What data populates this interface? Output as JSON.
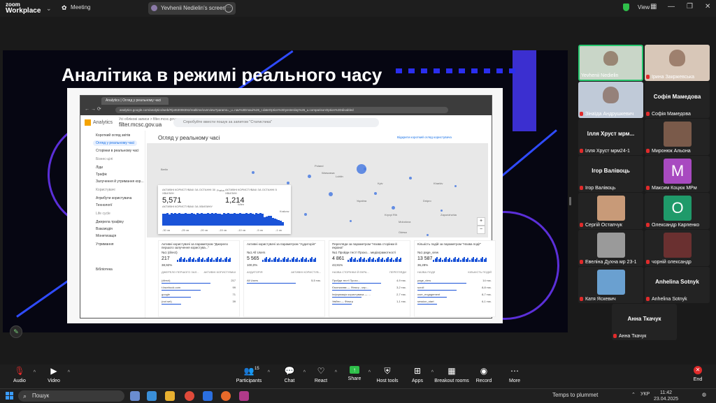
{
  "app": {
    "brand_line1": "zoom",
    "brand_line2": "Workplace",
    "meeting_label": "Meeting",
    "share_title": "Yevhenii Nedielin's screen",
    "view_label": "View"
  },
  "slide": {
    "title": "Аналітика в режимі реального часу",
    "browser_tab": "Analytics | Огляд у реальному часі",
    "url": "analytics.google.com/analytics/web/#/p463008392/realtime/overview?params=_u..nav%3Dmaui%26_r.dateOption%3Dyesterday%26_u.comparisonOption%3Ddisabled",
    "ga_title": "Analytics",
    "ga_property_small": "Усі облікові записи > filter.mcsc.gov.ua",
    "ga_property": "filter.mcsc.gov.ua",
    "ga_search": "Спробуйте ввести пошук за запитом \"Статистика\"",
    "sidebar": [
      {
        "label": "Короткий огляд звітів",
        "type": "item"
      },
      {
        "label": "Огляд у реальному часі",
        "type": "selected"
      },
      {
        "label": "Сторінки в реальному часі",
        "type": "item"
      },
      {
        "label": "Бізнес-цілі",
        "type": "section"
      },
      {
        "label": "Ліди",
        "type": "item"
      },
      {
        "label": "Трафік",
        "type": "item"
      },
      {
        "label": "Залучення й утримання кор...",
        "type": "item"
      },
      {
        "label": "Користувачі",
        "type": "section"
      },
      {
        "label": "Атрибути користувача",
        "type": "item"
      },
      {
        "label": "Технології",
        "type": "item"
      },
      {
        "label": "Life cycle",
        "type": "section"
      },
      {
        "label": "Джерела трафіку",
        "type": "item"
      },
      {
        "label": "Взаємодія",
        "type": "item"
      },
      {
        "label": "Монетизація",
        "type": "item"
      },
      {
        "label": "Утримання",
        "type": "item"
      },
      {
        "label": "Бібліотека",
        "type": "item"
      }
    ],
    "rt_title": "Огляд у реальному часі",
    "rt_link": "Відкрити короткий огляд користувача",
    "map_labels": [
      "Poland",
      "Warszawa",
      "Lublin",
      "Kyiv",
      "Berlin",
      "Praha",
      "Wien",
      "Україна",
      "Molodova",
      "Kharkiv",
      "Dnipro",
      "Odesa",
      "Krakow",
      "Kryvyi Rih",
      "Zaporizhzhia"
    ],
    "card": {
      "h1": "АКТИВНІ КОРИСТУВАЧІ ЗА ОСТАННІ 30 ХВИЛИН",
      "v1": "5,571",
      "sub1": "АКТИВНІ КОРИСТУВАЧІ ЗА ХВИЛИНУ",
      "h2": "АКТИВНІ КОРИСТУВАЧІ ЗА ОСТАННІ 5 ХВИЛИН",
      "v2": "1,214",
      "bars": [
        72,
        70,
        75,
        68,
        74,
        71,
        76,
        70,
        73,
        69,
        72,
        75,
        71,
        70,
        74,
        72,
        68,
        73,
        71,
        76,
        70,
        72,
        74,
        69,
        73,
        71,
        75,
        70,
        72,
        68,
        74,
        71,
        73,
        70,
        72,
        75,
        71,
        69,
        74,
        72,
        70,
        73,
        71,
        75,
        72,
        68,
        74,
        70,
        73,
        71,
        52,
        55,
        60,
        58,
        45,
        40,
        38,
        35,
        30,
        20
      ],
      "axis": [
        "-30 хв",
        "-25 хв",
        "-20 хв",
        "-15 хв",
        "-10 хв",
        "-5 хв",
        "-1 хв"
      ]
    },
    "panels": [
      {
        "title": "Активні користувачі за параметром \"Джерело першого залучення користува...\"",
        "sub": "№1 (direct)",
        "num": "217",
        "pct": "38,92%",
        "cols": [
          "ДЖЕРЕЛО ПЕРШОГО ЗАЛ...",
          "АКТИВНІ КОРИСТУВАЧІ"
        ],
        "rows": [
          [
            "(direct)",
            "217"
          ],
          [
            "t.facebook.com",
            "99"
          ],
          [
            "google",
            "71"
          ],
          [
            "(not set)",
            "39"
          ]
        ]
      },
      {
        "title": "Активні користувачі за параметром \"Аудиторія\"",
        "sub": "№1 All Users",
        "num": "5 565",
        "pct": "100,0%",
        "cols": [
          "АУДИТОРІЯ",
          "АКТИВНІ КОРИСТУВ..."
        ],
        "rows": [
          [
            "All Users",
            "5,5 тис."
          ]
        ]
      },
      {
        "title": "Перегляди за параметром \"Назва сторінки й екрана\"",
        "sub": "№1 Пройди тест! Прохо... медіаграмотності",
        "num": "4 861",
        "pct": "43,91%",
        "cols": [
          "НАЗВА СТОРІНКИ Й ЕКРА...",
          "ПЕРЕГЛЯДИ"
        ],
        "rows": [
          [
            "Пройди тест! Прохо...",
            "4,9 тис."
          ],
          [
            "Ємоткаєвм — Фільтр - кер...",
            "3,2 тис."
          ],
          [
            "Інформація користувача — ...",
            "2,7 тис."
          ],
          [
            "Увійти — Фільтр",
            "1,1 тис."
          ]
        ]
      },
      {
        "title": "Кількість подій за параметром \"Назва події\"",
        "sub": "№1 page_view",
        "num": "13 587",
        "pct": "36,28%",
        "cols": [
          "НАЗВА ПОДІЇ",
          "КІЛЬКІСТЬ ПОДІЙ"
        ],
        "rows": [
          [
            "page_view",
            "14 тис."
          ],
          [
            "scroll",
            "8,8 тис."
          ],
          [
            "user_engagement",
            "8,7 тис."
          ],
          [
            "session_start",
            "6,1 тис."
          ]
        ]
      }
    ]
  },
  "participants": [
    {
      "name": "Yevhenii Nedielin",
      "kind": "photo",
      "muted": false,
      "active": true,
      "color": "#c9d6c8"
    },
    {
      "name": "Ірина Закржевська",
      "kind": "photo",
      "muted": true,
      "color": "#d8c7b8"
    },
    {
      "name": "Зінаїда Андрушкевич",
      "kind": "photo",
      "muted": true,
      "color": "#c0cad8"
    },
    {
      "name": "Софія Мамедова",
      "kind": "text",
      "big": "Софія Мамедова",
      "muted": true
    },
    {
      "name": "Ілля Хруст мрм24-1",
      "kind": "text",
      "big": "Ілля Хруст мрм...",
      "muted": true
    },
    {
      "name": "Миронюк Альона",
      "kind": "avatar",
      "muted": true,
      "color": "#7a5a4a"
    },
    {
      "name": "Ігор Валівоць",
      "kind": "text",
      "big": "Ігор Валівоць",
      "muted": true
    },
    {
      "name": "Максим Коцюк МРм",
      "kind": "letter",
      "letter": "M",
      "muted": true,
      "color": "#a84ac0"
    },
    {
      "name": "Сергій Остапчук",
      "kind": "avatar",
      "muted": true,
      "color": "#c89a78"
    },
    {
      "name": "Олександр Карпенко",
      "kind": "letter",
      "letter": "O",
      "muted": true,
      "color": "#1f9a6a"
    },
    {
      "name": "Евеліна Духна мр 23-1",
      "kind": "avatar",
      "muted": true,
      "color": "#9a9a9a"
    },
    {
      "name": "чорній олександр",
      "kind": "avatar",
      "muted": true,
      "color": "#6a3030"
    },
    {
      "name": "Катя Яскевич",
      "kind": "avatar",
      "muted": true,
      "color": "#6aa0d0"
    },
    {
      "name": "Anhelina Sotnyk",
      "kind": "text",
      "big": "Anhelina Sotnyk",
      "muted": true
    },
    {
      "name": "Анна Ткачук",
      "kind": "text",
      "big": "Анна Ткачук",
      "muted": true
    }
  ],
  "toolbar": {
    "audio": "Audio",
    "video": "Video",
    "participants": "Participants",
    "participants_count": "15",
    "chat": "Chat",
    "react": "React",
    "share": "Share",
    "host_tools": "Host tools",
    "apps": "Apps",
    "breakout": "Breakout rooms",
    "record": "Record",
    "more": "More",
    "end": "End"
  },
  "taskbar": {
    "search": "Пошук",
    "weather": "Temps to plummet",
    "lang": "УКР",
    "time": "11:42",
    "date": "23.04.2025"
  }
}
